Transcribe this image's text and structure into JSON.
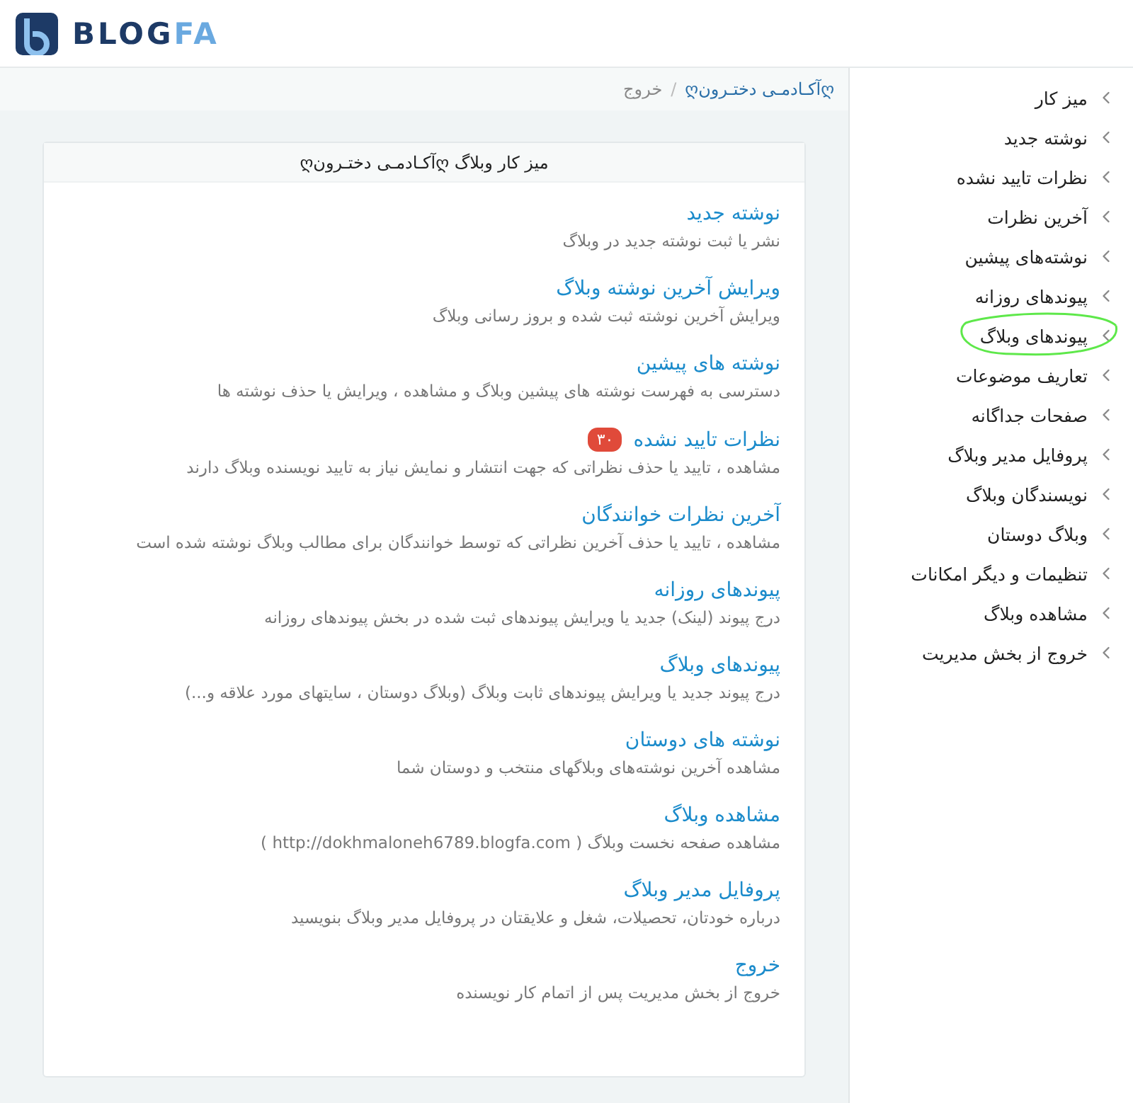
{
  "header": {
    "logo": {
      "dark": "BLOG",
      "light": "FA"
    }
  },
  "breadcrumb": [
    {
      "label": "ღآکـادمـی دختـرونღ",
      "kind": "link"
    },
    {
      "label": "/",
      "kind": "separator"
    },
    {
      "label": "خروج",
      "kind": "link"
    }
  ],
  "card": {
    "title": "میز کار وبلاگ ღآکـادمـی دختـرونღ",
    "items": [
      {
        "title": "نوشته جدید",
        "description": "نشر یا ثبت نوشته جدید در وبلاگ"
      },
      {
        "title": "ویرایش آخرین نوشته وبلاگ",
        "description": "ویرایش آخرین نوشته ثبت شده و بروز رسانی وبلاگ"
      },
      {
        "title": "نوشته های پیشین",
        "description": "دسترسی به فهرست نوشته های پیشین وبلاگ و مشاهده ، ویرایش یا حذف نوشته ها"
      },
      {
        "title": "نظرات تایید نشده",
        "badge": "۳۰",
        "description": "مشاهده ، تایید یا حذف نظراتی که جهت انتشار و نمایش نیاز به تایید نویسنده وبلاگ دارند"
      },
      {
        "title": "آخرین نظرات خوانندگان",
        "description": "مشاهده ، تایید یا حذف آخرین نظراتی که توسط خوانندگان برای مطالب وبلاگ نوشته شده است"
      },
      {
        "title": "پیوندهای روزانه",
        "description": "درج پیوند (لینک) جدید یا ویرایش پیوندهای ثبت شده در بخش پیوندهای روزانه"
      },
      {
        "title": "پیوندهای وبلاگ",
        "description": "درج پیوند جدید یا ویرایش پیوندهای ثابت وبلاگ (وبلاگ دوستان ، سایتهای مورد علاقه و...)"
      },
      {
        "title": "نوشته های دوستان",
        "description": "مشاهده آخرین نوشته‌های وبلاگهای منتخب و دوستان شما"
      },
      {
        "title": "مشاهده وبلاگ",
        "description": "مشاهده صفحه نخست وبلاگ ( http://dokhmaloneh6789.blogfa.com )"
      },
      {
        "title": "پروفایل مدیر وبلاگ",
        "description": "درباره خودتان، تحصیلات، شغل و علایقتان در پروفایل مدیر وبلاگ بنویسید"
      },
      {
        "title": "خروج",
        "description": "خروج از بخش مدیریت پس از اتمام کار نویسنده"
      }
    ]
  },
  "sidebar": {
    "items": [
      {
        "label": "میز کار",
        "circled": false
      },
      {
        "label": "نوشته جدید",
        "circled": false
      },
      {
        "label": "نظرات تایید نشده",
        "circled": false
      },
      {
        "label": "آخرین نظرات",
        "circled": false
      },
      {
        "label": "نوشته‌های پیشین",
        "circled": false
      },
      {
        "label": "پیوندهای روزانه",
        "circled": false
      },
      {
        "label": "پیوندهای وبلاگ",
        "circled": true
      },
      {
        "label": "تعاریف موضوعات",
        "circled": false
      },
      {
        "label": "صفحات جداگانه",
        "circled": false
      },
      {
        "label": "پروفایل مدیر وبلاگ",
        "circled": false
      },
      {
        "label": "نویسندگان وبلاگ",
        "circled": false
      },
      {
        "label": "وبلاگ دوستان",
        "circled": false
      },
      {
        "label": "تنظیمات و دیگر امکانات",
        "circled": false
      },
      {
        "label": "مشاهده وبلاگ",
        "circled": false
      },
      {
        "label": "خروج از بخش مدیریت",
        "circled": false
      }
    ]
  }
}
